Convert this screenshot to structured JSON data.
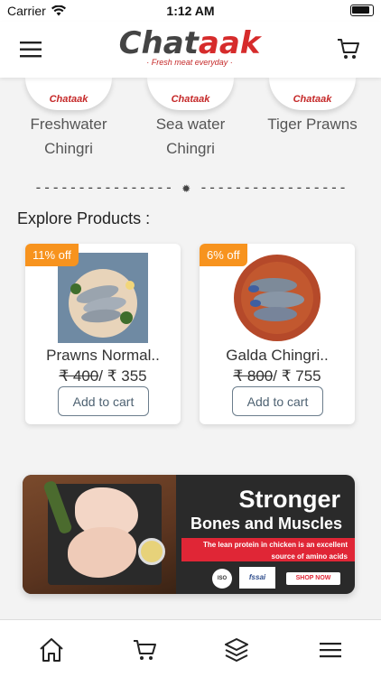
{
  "status_bar": {
    "carrier": "Carrier",
    "time": "1:12 AM"
  },
  "header": {
    "logo_text_main": "Chat",
    "logo_text_accent": "aak",
    "logo_tagline": "Fresh meat everyday"
  },
  "categories": [
    {
      "name_line1": "Freshwater",
      "name_line2": "Chingri",
      "thumb_text": "Chataak"
    },
    {
      "name_line1": "Sea water",
      "name_line2": "Chingri",
      "thumb_text": "Chataak"
    },
    {
      "name_line1": "Tiger Prawns",
      "name_line2": "",
      "thumb_text": "Chataak"
    }
  ],
  "divider": "---------------- ✹ -----------------",
  "section_title": "Explore Products :",
  "products": [
    {
      "discount": "11% off",
      "name": "Prawns Normal..",
      "old_price": "₹ 400",
      "separator": "/",
      "new_price": " ₹ 355",
      "button": "Add to cart"
    },
    {
      "discount": "6% off",
      "name": "Galda Chingri..",
      "old_price": "₹ 800",
      "separator": "/",
      "new_price": " ₹ 755",
      "button": "Add to cart"
    }
  ],
  "banner": {
    "headline1": "Stronger",
    "headline2": "Bones and Muscles",
    "subtext_line1": "The lean protein in chicken is an excellent",
    "subtext_line2": "source of amino acids",
    "cert1": "ISO",
    "fssai": "fssai",
    "cta": "SHOP NOW"
  },
  "tab_bar": {
    "icons": [
      "home-icon",
      "cart-icon",
      "layers-icon",
      "menu-icon"
    ]
  }
}
